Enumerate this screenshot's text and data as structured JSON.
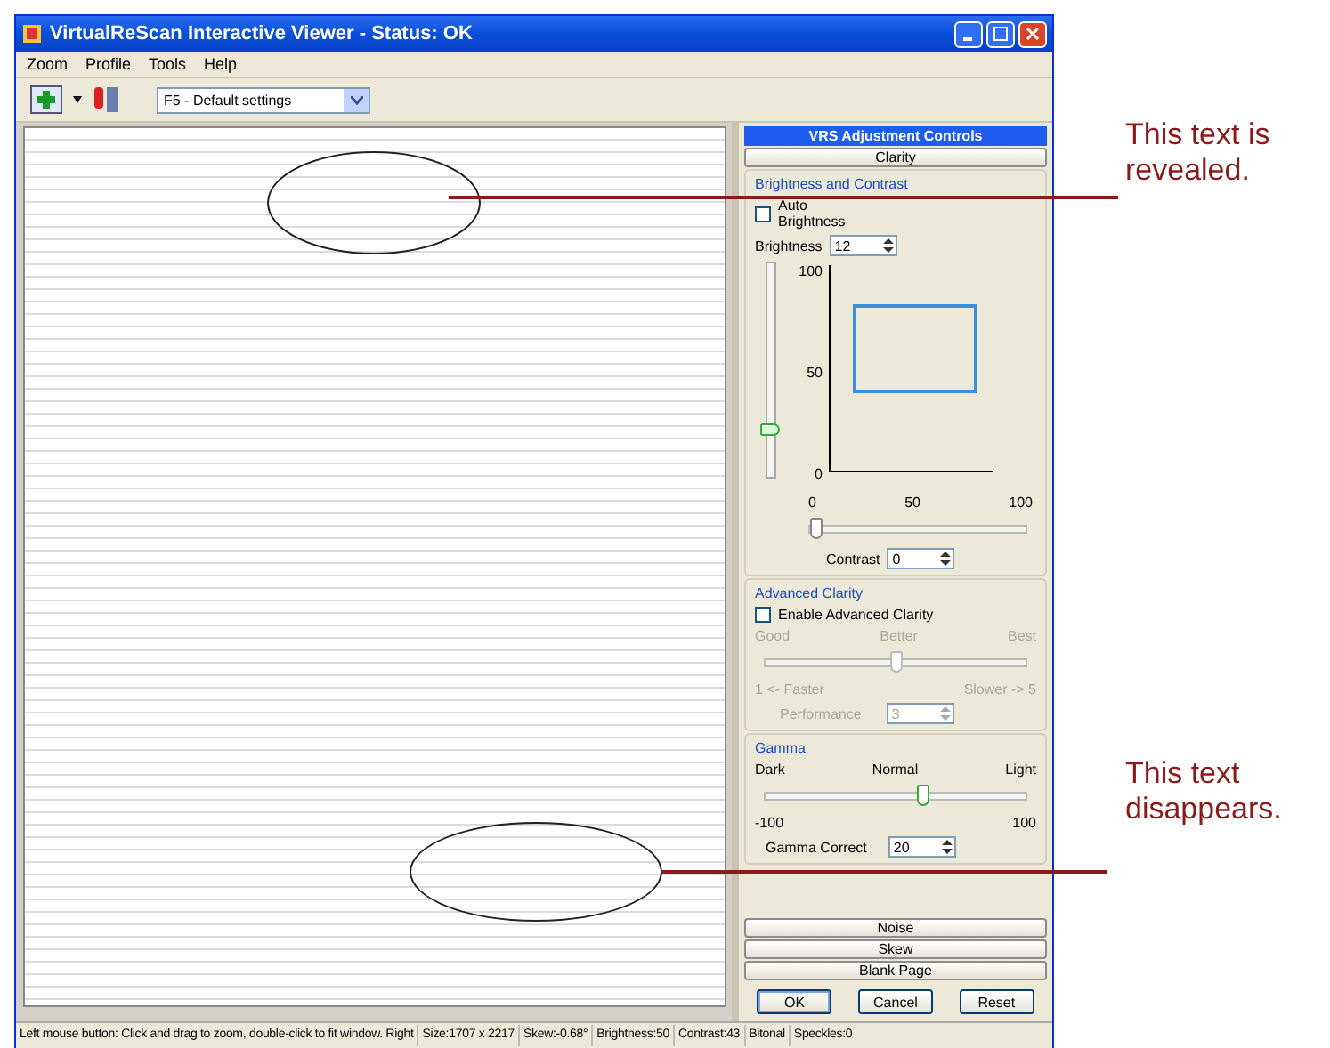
{
  "window": {
    "title": "VirtualReScan Interactive Viewer - Status: OK"
  },
  "menu": [
    "Zoom",
    "Profile",
    "Tools",
    "Help"
  ],
  "toolbar": {
    "profile": "F5 - Default settings"
  },
  "panel": {
    "title": "VRS Adjustment Controls",
    "top_tab": "Clarity",
    "brightness_contrast": {
      "title": "Brightness and Contrast",
      "auto_brightness": {
        "label": "Auto Brightness",
        "checked": false
      },
      "brightness": {
        "label": "Brightness",
        "value": "12",
        "level": 0.2
      },
      "y_ticks": [
        "100",
        "50",
        "0"
      ],
      "x_ticks": [
        "0",
        "50",
        "100"
      ],
      "contrast": {
        "label": "Contrast",
        "value": "0",
        "level": 0
      }
    },
    "advanced": {
      "title": "Advanced Clarity",
      "enable": {
        "label": "Enable Advanced Clarity",
        "checked": false
      },
      "disabled": true,
      "quality_labels": [
        "Good",
        "Better",
        "Best"
      ],
      "level": 0.5,
      "speed_labels": [
        "1 <- Faster",
        "Slower -> 5"
      ],
      "performance": {
        "label": "Performance",
        "value": "3"
      }
    },
    "gamma": {
      "title": "Gamma",
      "labels": [
        "Dark",
        "Normal",
        "Light"
      ],
      "level": 0.6,
      "range": [
        "-100",
        "100"
      ],
      "correct": {
        "label": "Gamma Correct",
        "value": "20"
      }
    },
    "bottom_tabs": [
      "Noise",
      "Skew",
      "Blank Page"
    ],
    "buttons": [
      {
        "label": "OK",
        "default": true
      },
      {
        "label": "Cancel",
        "default": false
      },
      {
        "label": "Reset",
        "default": false
      }
    ]
  },
  "status_bar": [
    "Left mouse button: Click and drag to zoom, double-click to fit window.  Right",
    "Size:1707 x 2217",
    "Skew:-0.68°",
    "Brightness:50",
    "Contrast:43",
    "Bitonal",
    "Speckles:0"
  ],
  "callouts": [
    "This text is revealed.",
    "This text disappears."
  ]
}
